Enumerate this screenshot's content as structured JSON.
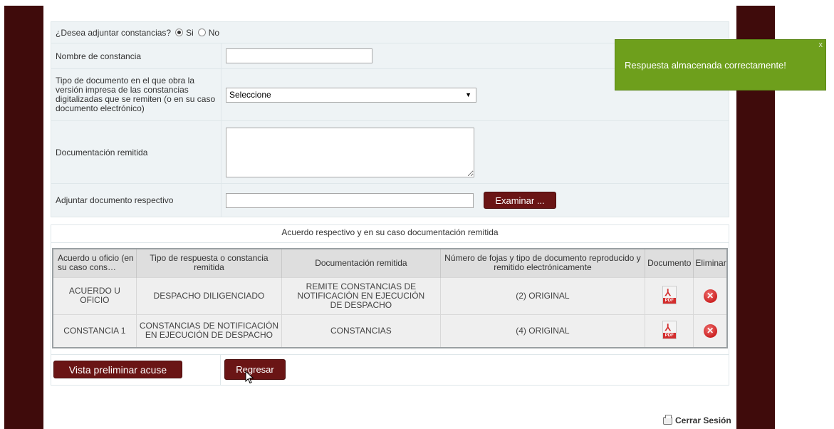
{
  "form": {
    "attach_question": "¿Desea adjuntar constancias?",
    "opt_yes": "Si",
    "opt_no": "No",
    "nombre_label": "Nombre de constancia",
    "nombre_value": "",
    "tipo_label": "Tipo de documento en el que obra la versión impresa de las constancias digitalizadas que se remiten (o en su caso documento electrónico)",
    "tipo_value": "Seleccione",
    "doc_label": "Documentación remitida",
    "doc_value": "",
    "adjuntar_label": "Adjuntar documento respectivo",
    "file_value": "",
    "browse_button": "Examinar ..."
  },
  "table": {
    "caption": "Acuerdo respectivo y en su caso documentación remitida",
    "headers": [
      "Acuerdo u oficio (en su caso cons…",
      "Tipo de respuesta o constancia remitida",
      "Documentación remitida",
      "Número de fojas y tipo de documento reproducido y remitido electrónicamente",
      "Documento",
      "Eliminar"
    ],
    "rows": [
      {
        "acuerdo": "ACUERDO U OFICIO",
        "tipo": "DESPACHO DILIGENCIADO",
        "documentacion": "REMITE CONSTANCIAS DE NOTIFICACIÓN EN EJECUCIÓN DE DESPACHO",
        "fojas": "(2) ORIGINAL",
        "doc_icon": "pdf-icon",
        "del_icon": "delete-icon"
      },
      {
        "acuerdo": "CONSTANCIA 1",
        "tipo": "CONSTANCIAS DE NOTIFICACIÓN EN EJECUCIÓN DE DESPACHO",
        "documentacion": "CONSTANCIAS",
        "fojas": "(4) ORIGINAL",
        "doc_icon": "pdf-icon",
        "del_icon": "delete-icon"
      }
    ],
    "pdf_tag": "PDF"
  },
  "actions": {
    "preview_button": "Vista preliminar acuse",
    "back_button": "Regresar"
  },
  "toast": {
    "message": "Respuesta almacenada correctamente!",
    "close": "x"
  },
  "footer": {
    "logout": "Cerrar Sesión"
  },
  "colors": {
    "maroon": "#3f0b0b",
    "button": "#6a1515",
    "toast": "#6e9f1c",
    "panel": "#eef3f5"
  }
}
